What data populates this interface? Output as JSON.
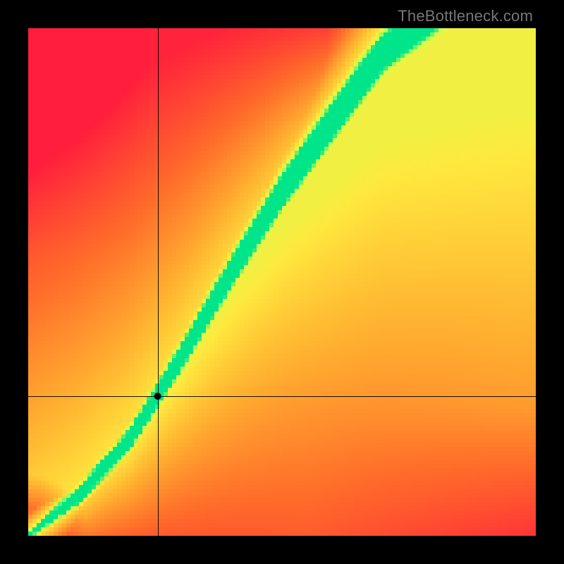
{
  "watermark": "TheBottleneck.com",
  "chart_data": {
    "type": "heatmap",
    "title": "",
    "xlabel": "",
    "ylabel": "",
    "xlim": [
      0,
      1
    ],
    "ylim": [
      0,
      1
    ],
    "grid_resolution": 120,
    "crosshair": {
      "x": 0.255,
      "y": 0.275
    },
    "marker": {
      "x": 0.255,
      "y": 0.275
    },
    "colorscale": [
      {
        "stop": 0.0,
        "color": "#ff1e3c"
      },
      {
        "stop": 0.3,
        "color": "#ff6a2a"
      },
      {
        "stop": 0.55,
        "color": "#ffb030"
      },
      {
        "stop": 0.75,
        "color": "#ffe83e"
      },
      {
        "stop": 0.9,
        "color": "#d4ff4a"
      },
      {
        "stop": 1.0,
        "color": "#00e58a"
      }
    ],
    "ideal_curve": {
      "description": "optimal y as function of x; green ridge follows this",
      "points": [
        {
          "x": 0.0,
          "y": 0.0
        },
        {
          "x": 0.1,
          "y": 0.08
        },
        {
          "x": 0.2,
          "y": 0.19
        },
        {
          "x": 0.3,
          "y": 0.35
        },
        {
          "x": 0.4,
          "y": 0.52
        },
        {
          "x": 0.5,
          "y": 0.68
        },
        {
          "x": 0.6,
          "y": 0.82
        },
        {
          "x": 0.7,
          "y": 0.96
        },
        {
          "x": 0.75,
          "y": 1.0
        }
      ]
    },
    "ridge_width": {
      "base": 0.015,
      "growth": 0.055
    },
    "series": []
  }
}
